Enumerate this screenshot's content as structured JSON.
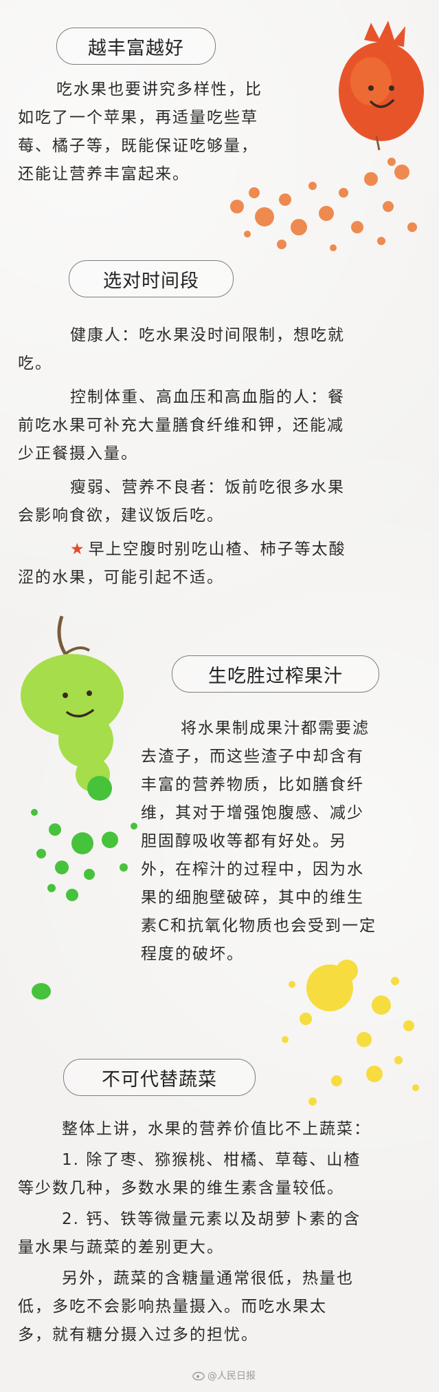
{
  "section1": {
    "heading": "越丰富越好",
    "lines": [
      "吃水果也要讲究多样性，比",
      "如吃了一个苹果，再适量吃些草",
      "莓、橘子等，既能保证吃够量，",
      "还能让营养丰富起来。"
    ]
  },
  "section2": {
    "heading": "选对时间段",
    "p1": [
      "健康人：吃水果没时间限制，想吃就",
      "吃。"
    ],
    "p2": [
      "控制体重、高血压和高血脂的人：餐",
      "前吃水果可补充大量膳食纤维和钾，还能减",
      "少正餐摄入量。"
    ],
    "p3": [
      "瘦弱、营养不良者：饭前吃很多水果",
      "会影响食欲，建议饭后吃。"
    ],
    "p4_star": "★",
    "p4": [
      "早上空腹时别吃山楂、柿子等太酸",
      "涩的水果，可能引起不适。"
    ]
  },
  "section3": {
    "heading": "生吃胜过榨果汁",
    "lines": [
      "将水果制成果汁都需要滤",
      "去渣子，而这些渣子中却含有",
      "丰富的营养物质，比如膳食纤",
      "维，其对于增强饱腹感、减少",
      "胆固醇吸收等都有好处。另",
      "外，在榨汁的过程中，因为水",
      "果的细胞壁破碎，其中的维生",
      "素C和抗氧化物质也会受到一定",
      "程度的破坏。"
    ]
  },
  "section4": {
    "heading": "不可代替蔬菜",
    "p1": [
      "整体上讲，水果的营养价值比不上蔬菜："
    ],
    "p2": [
      "1. 除了枣、猕猴桃、柑橘、草莓、山楂",
      "等少数几种，多数水果的维生素含量较低。"
    ],
    "p3": [
      "2. 钙、铁等微量元素以及胡萝卜素的含",
      "量水果与蔬菜的差别更大。"
    ],
    "p4": [
      "另外，蔬菜的含糖量通常很低，热量也",
      "低，多吃不会影响热量摄入。而吃水果太",
      "多，就有糖分摄入过多的担忧。"
    ]
  },
  "watermark": "@人民日报",
  "colors": {
    "orange": "#ee8a4f",
    "pomegranate": "#e8542a",
    "green": "#47c23b",
    "lightgreen": "#a6dd4a",
    "yellow": "#f6dc3f"
  }
}
